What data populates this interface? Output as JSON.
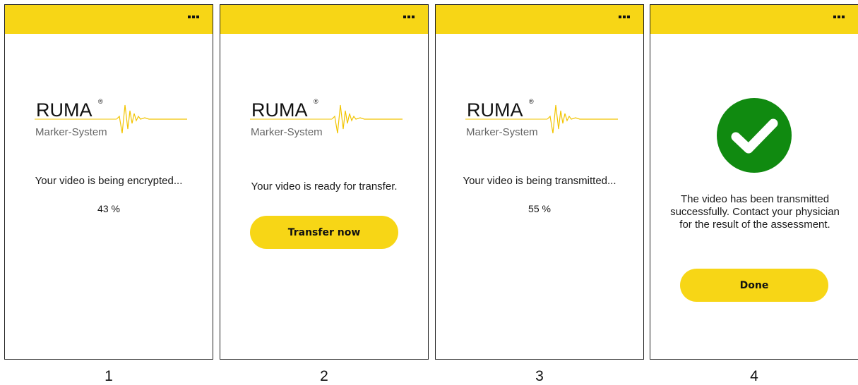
{
  "brand": {
    "name": "RUMA",
    "registered": "®",
    "subtitle": "Marker-System"
  },
  "screens": [
    {
      "caption": "1",
      "message": "Your video is being encrypted...",
      "progress": "43 %"
    },
    {
      "caption": "2",
      "message": "Your video is ready for transfer.",
      "button_label": "Transfer now"
    },
    {
      "caption": "3",
      "message": "Your video is being transmitted...",
      "progress": "55 %"
    },
    {
      "caption": "4",
      "message": "The video has been transmitted successfully. Contact your physician for the result of the assessment.",
      "button_label": "Done",
      "icon": "checkmark-success-icon"
    }
  ],
  "colors": {
    "accent": "#f7d616",
    "success": "#108a10"
  }
}
